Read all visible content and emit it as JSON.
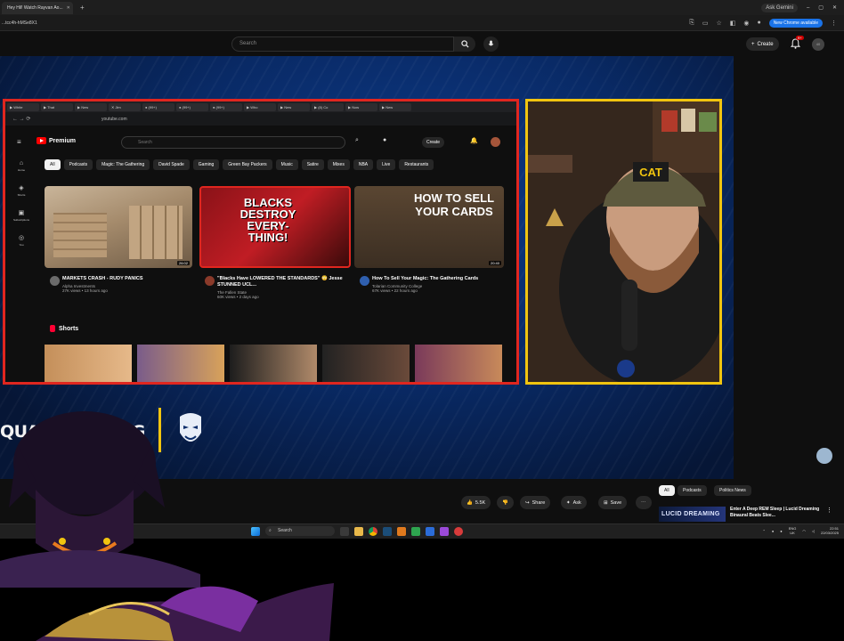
{
  "browser": {
    "tab_title": "Hey Hil! Watch Rayvan Ao...",
    "url": "...tcc4h-hMSe8X1",
    "ask_gemini": "Ask Gemini",
    "update_label": "New Chrome available"
  },
  "youtube": {
    "search_placeholder": "Search",
    "create_label": "Create",
    "notif_count": "9+",
    "avatar_label": "40"
  },
  "capture": {
    "url": "youtube.com",
    "logo_label": "Premium",
    "search_placeholder": "Search",
    "create_label": "Create",
    "chips": [
      "All",
      "Podcasts",
      "Magic: The Gathering",
      "David Spade",
      "Gaming",
      "Green Bay Packers",
      "Music",
      "Satire",
      "Mixes",
      "NBA",
      "Live",
      "Restaurants"
    ],
    "nav": [
      "Home",
      "Shorts",
      "Subscriptions",
      "You"
    ],
    "videos": [
      {
        "title": "MARKETS CRASH - RUDY PANICS",
        "channel": "Alpha Investments",
        "stats": "27K views • 13 hours ago",
        "duration": "26:02",
        "thumb_text": ""
      },
      {
        "title": "\"Blacks Have LOWERED THE STANDARDS\" 😳 Jesse STUNNED UCL...",
        "channel": "The Fallen State",
        "stats": "60K views • 2 days ago",
        "duration": "",
        "thumb_text": "BLACKS DESTROY EVERY- THING!"
      },
      {
        "title": "How To Sell Your Magic: The Gathering Cards",
        "channel": "Tolarian Community College",
        "stats": "67K views • 22 hours ago",
        "duration": "20:40",
        "thumb_text": "HOW TO SELL YOUR CARDS"
      }
    ],
    "shorts_label": "Shorts"
  },
  "webcam": {
    "cap_text": "CAT"
  },
  "banner": {
    "name": "QUANTUM KING"
  },
  "player_actions": {
    "like_count": "5.5K",
    "share": "Share",
    "ask": "Ask",
    "save": "Save"
  },
  "related_filters": [
    "All",
    "Podcasts",
    "Politics News"
  ],
  "recommended": {
    "thumb_text": "LUCID DREAMING",
    "title": "Enter A Deep REM Sleep | Lucid Dreaming Binaural Beats Slee..."
  },
  "taskbar": {
    "search_placeholder": "Search",
    "lang": "ENG",
    "region": "UK",
    "time": "22:51",
    "date": "22/03/2025"
  },
  "colors": {
    "capture_border": "#e0261f",
    "webcam_border": "#f1c40f",
    "youtube_red": "#ff0000",
    "video_bg": "#092a66"
  }
}
